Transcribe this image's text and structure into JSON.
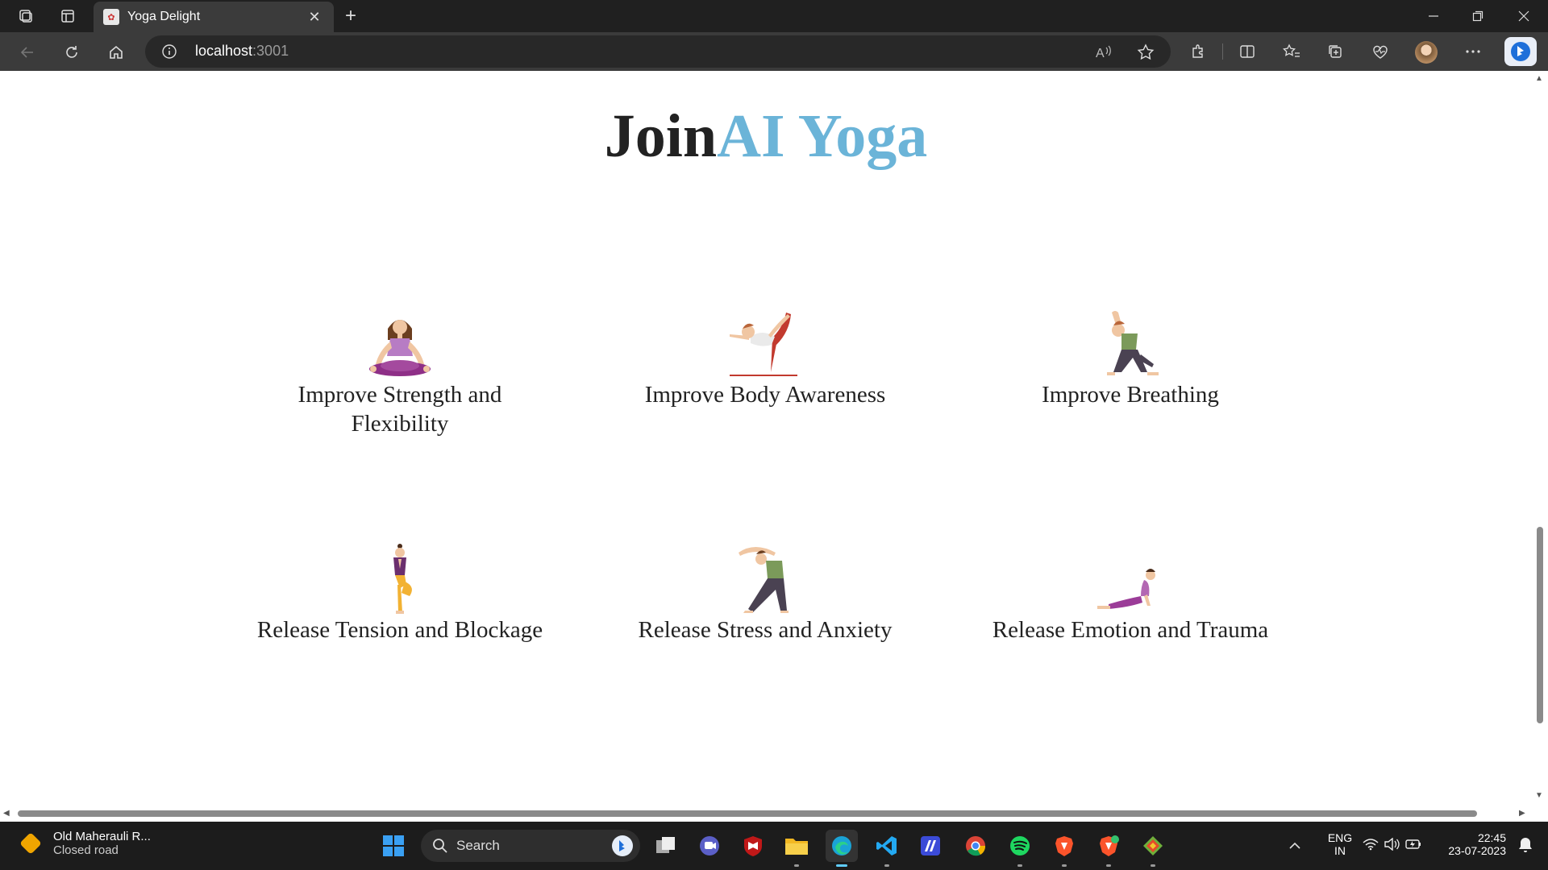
{
  "browser": {
    "tab_title": "Yoga Delight",
    "url_host": "localhost",
    "url_port": ":3001"
  },
  "page": {
    "heading_part1": "Join",
    "heading_part2": "AI Yoga",
    "cards": [
      {
        "label": "Improve Strength and Flexibility",
        "icon": "lotus-pose-icon"
      },
      {
        "label": "Improve Body Awareness",
        "icon": "dancer-pose-icon"
      },
      {
        "label": "Improve Breathing",
        "icon": "lunge-pose-icon"
      },
      {
        "label": "Release Tension and Blockage",
        "icon": "tree-pose-icon"
      },
      {
        "label": "Release Stress and Anxiety",
        "icon": "side-bend-pose-icon"
      },
      {
        "label": "Release Emotion and Trauma",
        "icon": "cobra-pose-icon"
      }
    ]
  },
  "taskbar": {
    "weather_title": "Old Maherauli R...",
    "weather_sub": "Closed road",
    "search_label": "Search",
    "lang1": "ENG",
    "lang2": "IN",
    "time": "22:45",
    "date": "23-07-2023"
  },
  "colors": {
    "accent_heading": "#6bb4d8",
    "chrome_dark": "#202020",
    "toolbar": "#3b3b3b"
  }
}
